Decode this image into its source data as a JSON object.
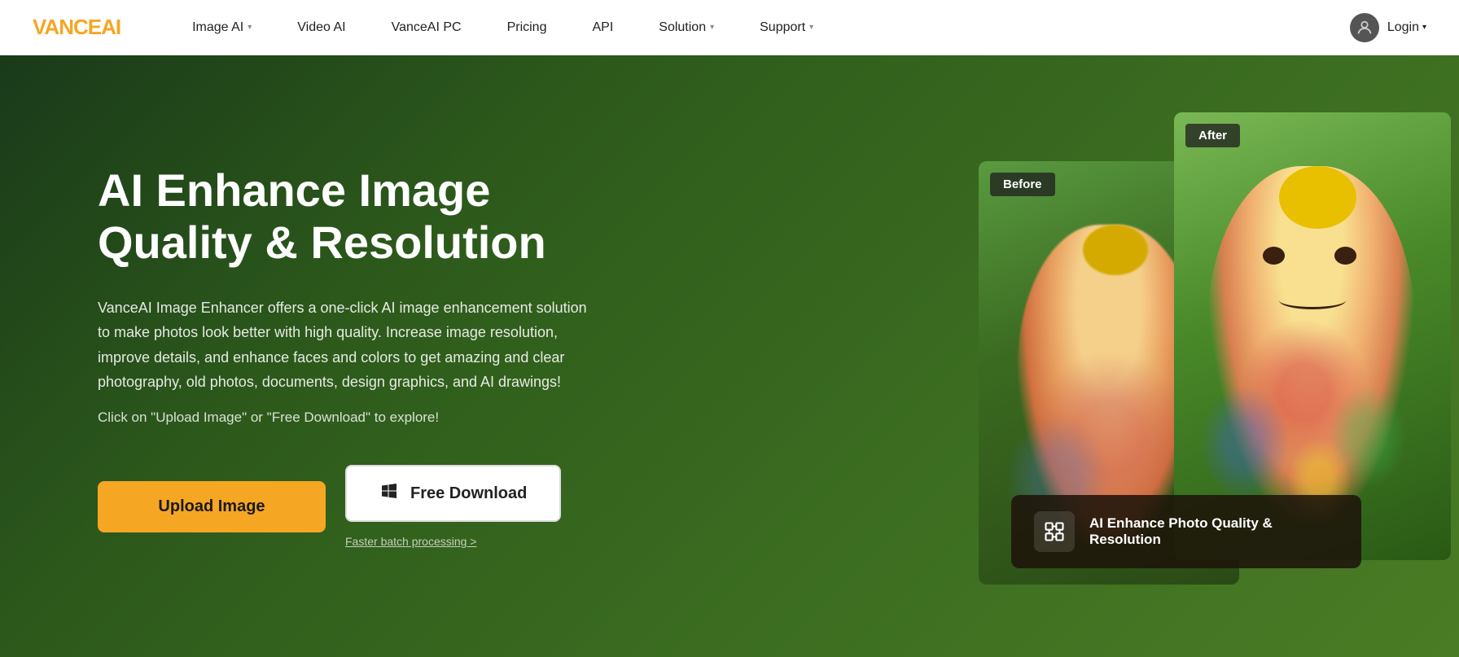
{
  "brand": {
    "name_part1": "VANCE",
    "name_part2": "AI"
  },
  "nav": {
    "items": [
      {
        "label": "Image AI",
        "has_dropdown": true
      },
      {
        "label": "Video AI",
        "has_dropdown": false
      },
      {
        "label": "VanceAI PC",
        "has_dropdown": false
      },
      {
        "label": "Pricing",
        "has_dropdown": false
      },
      {
        "label": "API",
        "has_dropdown": false
      },
      {
        "label": "Solution",
        "has_dropdown": true
      },
      {
        "label": "Support",
        "has_dropdown": true
      }
    ],
    "login_label": "Login"
  },
  "hero": {
    "title": "AI Enhance Image Quality & Resolution",
    "description": "VanceAI Image Enhancer offers a one-click AI image enhancement solution to make photos look better with high quality. Increase image resolution, improve details, and enhance faces and colors to get amazing and clear photography, old photos, documents, design graphics, and AI drawings!",
    "cta_text": "Click on \"Upload Image\" or \"Free Download\" to explore!",
    "btn_upload": "Upload Image",
    "btn_download": "Free Download",
    "btn_batch": "Faster batch processing >"
  },
  "comparison": {
    "before_label": "Before",
    "after_label": "After"
  },
  "ai_card": {
    "icon": "⤢",
    "text": "AI Enhance Photo Quality & Resolution"
  }
}
